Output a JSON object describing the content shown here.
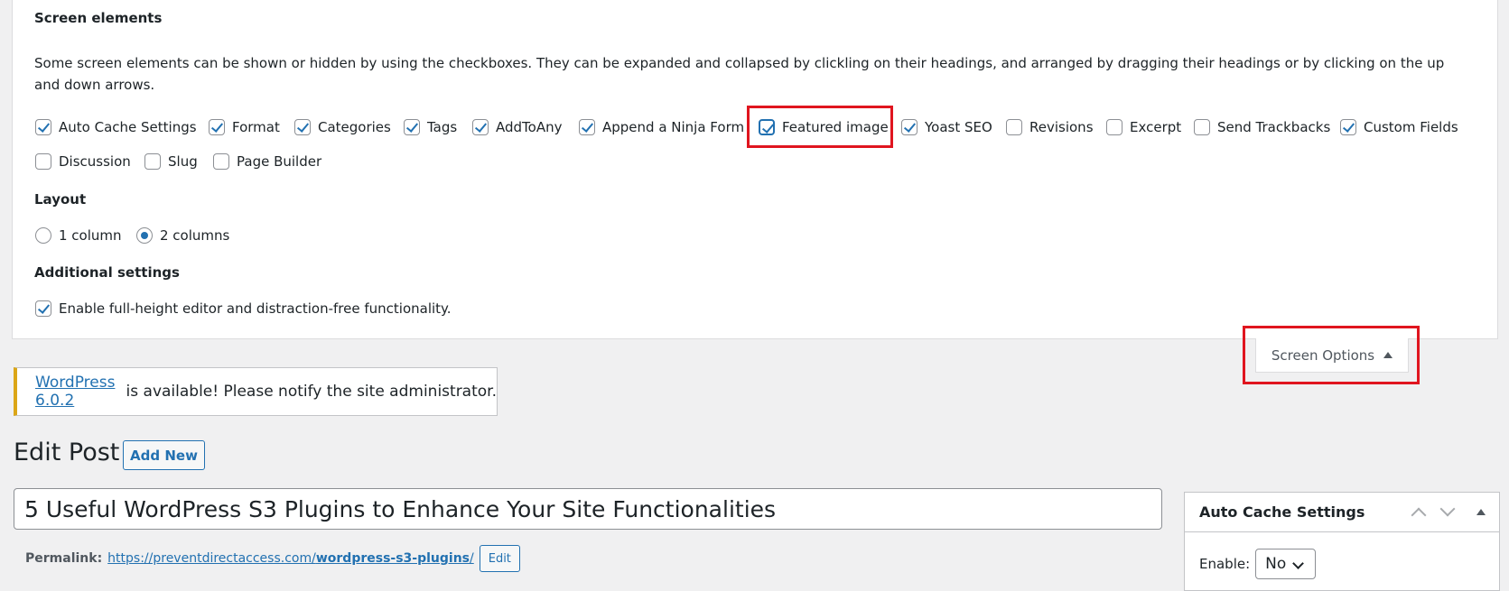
{
  "screen_options": {
    "elements_heading": "Screen elements",
    "description": "Some screen elements can be shown or hidden by using the checkboxes. They can be expanded and collapsed by clickling on their headings, and arranged by dragging their headings or by clicking on the up and down arrows.",
    "checkboxes": [
      {
        "label": "Auto Cache Settings",
        "checked": true
      },
      {
        "label": "Format",
        "checked": true
      },
      {
        "label": "Categories",
        "checked": true
      },
      {
        "label": "Tags",
        "checked": true
      },
      {
        "label": "AddToAny",
        "checked": true
      },
      {
        "label": "Append a Ninja Form",
        "checked": true
      },
      {
        "label": "Featured image",
        "checked": true
      },
      {
        "label": "Yoast SEO",
        "checked": true
      },
      {
        "label": "Revisions",
        "checked": false
      },
      {
        "label": "Excerpt",
        "checked": false
      },
      {
        "label": "Send Trackbacks",
        "checked": false
      },
      {
        "label": "Custom Fields",
        "checked": true
      },
      {
        "label": "Discussion",
        "checked": false
      },
      {
        "label": "Slug",
        "checked": false
      },
      {
        "label": "Page Builder",
        "checked": false
      }
    ],
    "layout_heading": "Layout",
    "layout_options": [
      {
        "label": "1 column",
        "checked": false
      },
      {
        "label": "2 columns",
        "checked": true
      }
    ],
    "additional_heading": "Additional settings",
    "additional_option": {
      "label": "Enable full-height editor and distraction-free functionality.",
      "checked": true
    },
    "toggle_label": "Screen Options"
  },
  "notice": {
    "link_text": "WordPress 6.0.2",
    "text": " is available! Please notify the site administrator."
  },
  "page": {
    "title": "Edit Post",
    "add_new": "Add New"
  },
  "post": {
    "title": "5 Useful WordPress S3 Plugins to Enhance Your Site Functionalities",
    "permalink_label": "Permalink:",
    "permalink_base": "https://preventdirectaccess.com/",
    "permalink_slug": "wordpress-s3-plugins",
    "permalink_tail": "/",
    "edit_label": "Edit"
  },
  "sidebar": {
    "box_title": "Auto Cache Settings",
    "enable_label": "Enable:",
    "enable_value": "No"
  },
  "colors": {
    "accent": "#2271b1",
    "highlight": "#e0151f",
    "notice_border": "#dba617"
  }
}
